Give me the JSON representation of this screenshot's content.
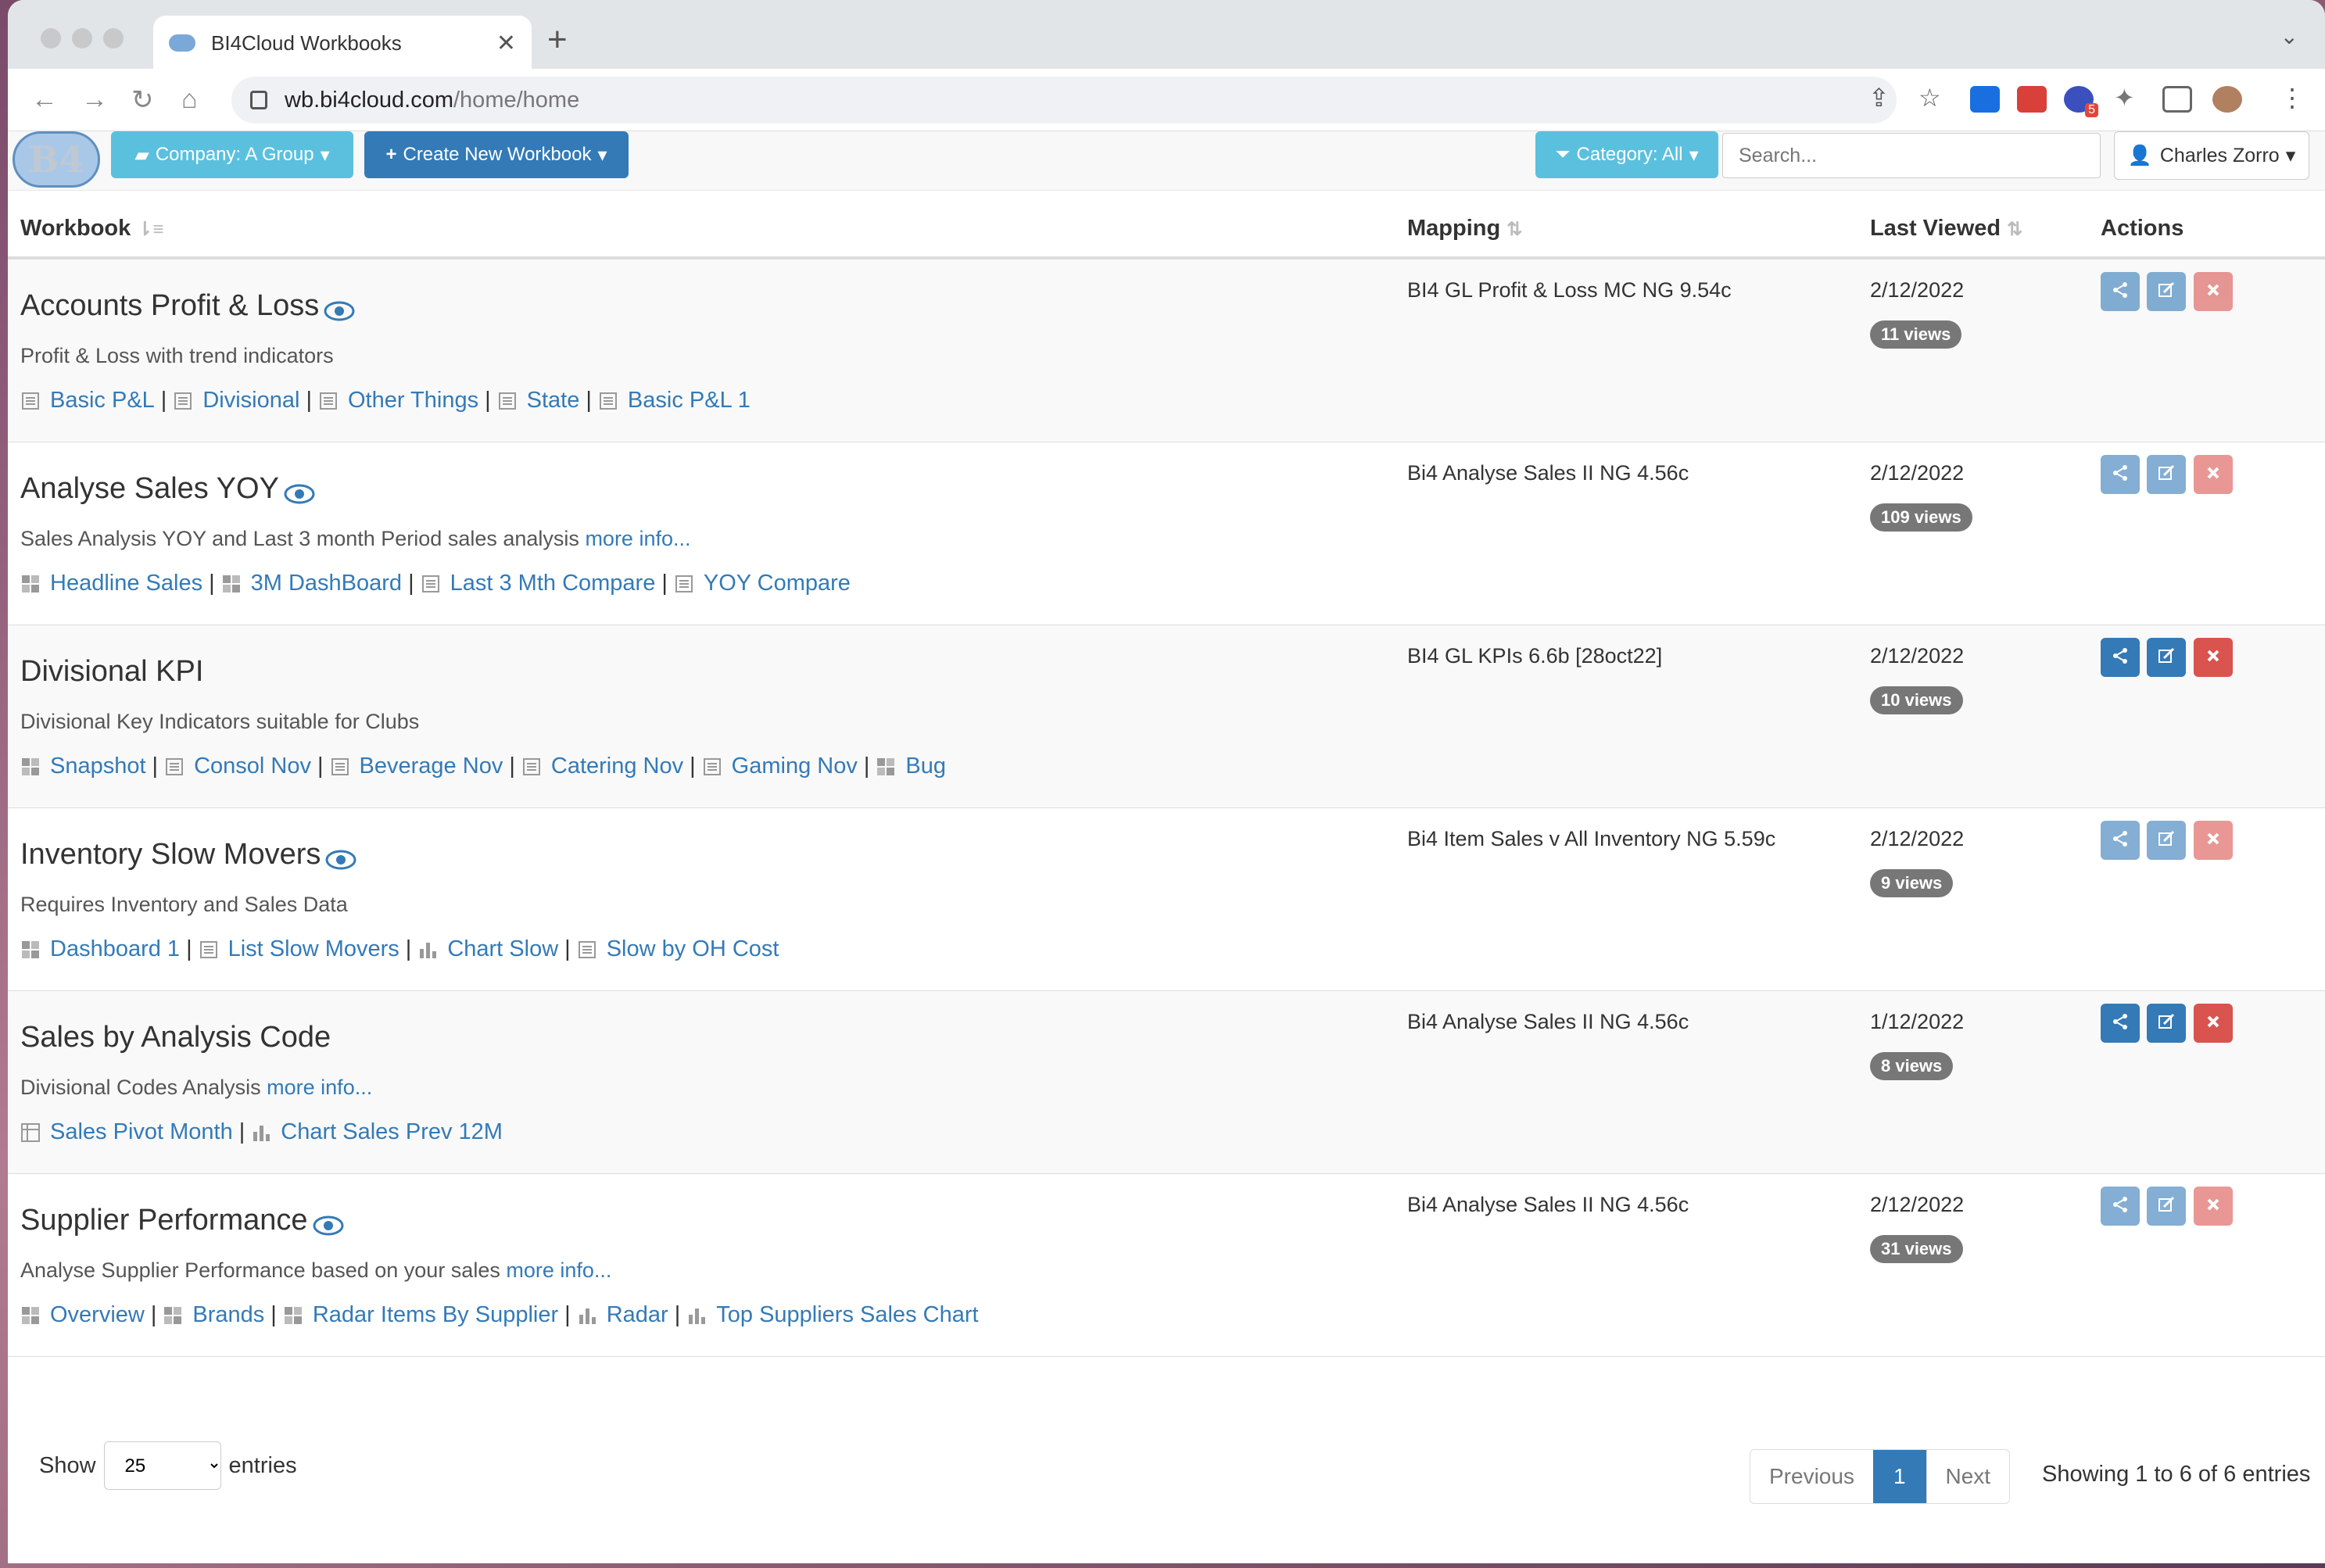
{
  "browser": {
    "tab_title": "BI4Cloud Workbooks",
    "url_host": "wb.bi4cloud.com",
    "url_path": "/home/home",
    "extension_badge": "5"
  },
  "nav": {
    "logo": "B4",
    "company_label": "Company: A Group",
    "create_label": "Create New Workbook",
    "category_label": "Category: All",
    "search_placeholder": "Search...",
    "user_label": "Charles Zorro"
  },
  "table": {
    "headers": {
      "workbook": "Workbook",
      "mapping": "Mapping",
      "last_viewed": "Last Viewed",
      "actions": "Actions"
    },
    "rows": [
      {
        "title": "Accounts Profit & Loss",
        "eye": true,
        "desc": "Profit & Loss with trend indicators",
        "more": "",
        "mapping": "BI4 GL Profit & Loss MC NG 9.54c",
        "date": "2/12/2022",
        "views": "11 views",
        "dim": true,
        "sheets": [
          {
            "icon": "list-icon",
            "label": "Basic P&L"
          },
          {
            "icon": "list-icon",
            "label": "Divisional"
          },
          {
            "icon": "list-icon",
            "label": "Other Things"
          },
          {
            "icon": "list-icon",
            "label": "State"
          },
          {
            "icon": "list-icon",
            "label": "Basic P&L 1"
          }
        ]
      },
      {
        "title": "Analyse Sales YOY",
        "eye": true,
        "desc": "Sales Analysis YOY and Last 3 month Period sales analysis",
        "more": "more info...",
        "mapping": "Bi4 Analyse Sales II NG 4.56c",
        "date": "2/12/2022",
        "views": "109 views",
        "dim": true,
        "sheets": [
          {
            "icon": "dashboard-icon",
            "label": "Headline Sales"
          },
          {
            "icon": "dashboard-icon",
            "label": "3M DashBoard"
          },
          {
            "icon": "list-icon",
            "label": "Last 3 Mth Compare"
          },
          {
            "icon": "list-icon",
            "label": "YOY Compare"
          }
        ]
      },
      {
        "title": "Divisional KPI",
        "eye": false,
        "desc": "Divisional Key Indicators suitable for Clubs",
        "more": "",
        "mapping": "BI4 GL KPIs 6.6b [28oct22]",
        "date": "2/12/2022",
        "views": "10 views",
        "dim": false,
        "sheets": [
          {
            "icon": "dashboard-icon",
            "label": "Snapshot"
          },
          {
            "icon": "list-icon",
            "label": "Consol Nov"
          },
          {
            "icon": "list-icon",
            "label": "Beverage Nov"
          },
          {
            "icon": "list-icon",
            "label": "Catering Nov"
          },
          {
            "icon": "list-icon",
            "label": "Gaming Nov"
          },
          {
            "icon": "dashboard-icon",
            "label": "Bug"
          }
        ]
      },
      {
        "title": "Inventory Slow Movers",
        "eye": true,
        "desc": "Requires Inventory and Sales Data",
        "more": "",
        "mapping": "Bi4 Item Sales v All Inventory NG 5.59c",
        "date": "2/12/2022",
        "views": "9 views",
        "dim": true,
        "sheets": [
          {
            "icon": "dashboard-icon",
            "label": "Dashboard 1"
          },
          {
            "icon": "list-icon",
            "label": "List Slow Movers"
          },
          {
            "icon": "bar-chart-icon",
            "label": "Chart Slow"
          },
          {
            "icon": "list-icon",
            "label": "Slow by OH Cost"
          }
        ]
      },
      {
        "title": "Sales by Analysis Code",
        "eye": false,
        "desc": "Divisional Codes Analysis",
        "more": "more info...",
        "mapping": "Bi4 Analyse Sales II NG 4.56c",
        "date": "1/12/2022",
        "views": "8 views",
        "dim": false,
        "sheets": [
          {
            "icon": "pivot-icon",
            "label": "Sales Pivot Month"
          },
          {
            "icon": "bar-chart-icon",
            "label": "Chart Sales Prev 12M"
          }
        ]
      },
      {
        "title": "Supplier Performance",
        "eye": true,
        "desc": "Analyse Supplier Performance based on your sales",
        "more": "more info...",
        "mapping": "Bi4 Analyse Sales II NG 4.56c",
        "date": "2/12/2022",
        "views": "31 views",
        "dim": true,
        "sheets": [
          {
            "icon": "dashboard-icon",
            "label": "Overview"
          },
          {
            "icon": "dashboard-icon",
            "label": "Brands"
          },
          {
            "icon": "dashboard-icon",
            "label": "Radar Items By Supplier"
          },
          {
            "icon": "bar-chart-icon",
            "label": "Radar"
          },
          {
            "icon": "bar-chart-icon",
            "label": "Top Suppliers Sales Chart"
          }
        ]
      }
    ]
  },
  "footer": {
    "show_label": "Show",
    "entries_value": "25",
    "entries_label": "entries",
    "prev_label": "Previous",
    "page": "1",
    "next_label": "Next",
    "info": "Showing 1 to 6 of 6 entries"
  },
  "colors": {
    "primary": "#337ab7",
    "info": "#5bc0de",
    "danger": "#d9534f",
    "badge": "#777777"
  }
}
